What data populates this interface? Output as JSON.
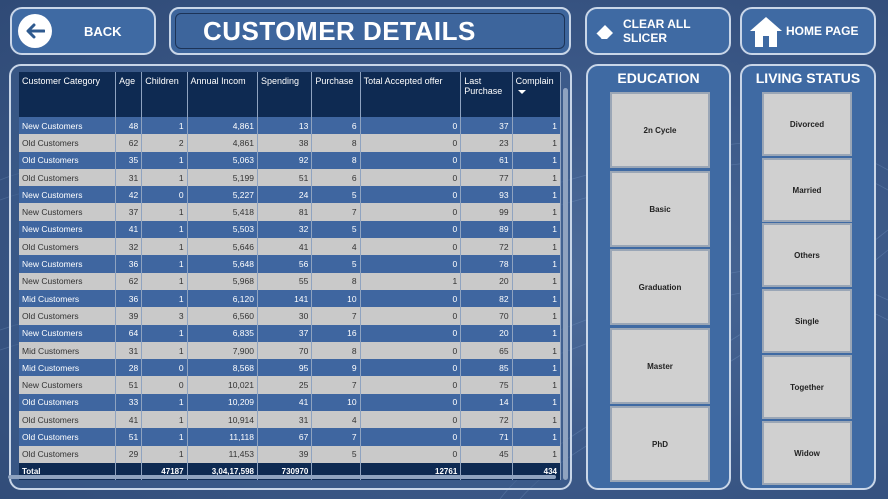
{
  "header": {
    "back_label": "BACK",
    "title": "CUSTOMER DETAILS",
    "clear_label": "CLEAR ALL SLICER",
    "home_label": "HOME PAGE"
  },
  "table": {
    "columns": [
      "Customer Category",
      "Age",
      "Children",
      "Annual Incom",
      "Spending",
      "Purchase",
      "Total Accepted offer",
      "Last Purchase",
      "Complain"
    ],
    "rows": [
      [
        "New Customers",
        "48",
        "1",
        "4,861",
        "13",
        "6",
        "0",
        "37",
        "1"
      ],
      [
        "Old Customers",
        "62",
        "2",
        "4,861",
        "38",
        "8",
        "0",
        "23",
        "1"
      ],
      [
        "Old Customers",
        "35",
        "1",
        "5,063",
        "92",
        "8",
        "0",
        "61",
        "1"
      ],
      [
        "Old Customers",
        "31",
        "1",
        "5,199",
        "51",
        "6",
        "0",
        "77",
        "1"
      ],
      [
        "New Customers",
        "42",
        "0",
        "5,227",
        "24",
        "5",
        "0",
        "93",
        "1"
      ],
      [
        "New Customers",
        "37",
        "1",
        "5,418",
        "81",
        "7",
        "0",
        "99",
        "1"
      ],
      [
        "New Customers",
        "41",
        "1",
        "5,503",
        "32",
        "5",
        "0",
        "89",
        "1"
      ],
      [
        "Old Customers",
        "32",
        "1",
        "5,646",
        "41",
        "4",
        "0",
        "72",
        "1"
      ],
      [
        "New Customers",
        "36",
        "1",
        "5,648",
        "56",
        "5",
        "0",
        "78",
        "1"
      ],
      [
        "New Customers",
        "62",
        "1",
        "5,968",
        "55",
        "8",
        "1",
        "20",
        "1"
      ],
      [
        "Mid Customers",
        "36",
        "1",
        "6,120",
        "141",
        "10",
        "0",
        "82",
        "1"
      ],
      [
        "Old Customers",
        "39",
        "3",
        "6,560",
        "30",
        "7",
        "0",
        "70",
        "1"
      ],
      [
        "New Customers",
        "64",
        "1",
        "6,835",
        "37",
        "16",
        "0",
        "20",
        "1"
      ],
      [
        "Mid Customers",
        "31",
        "1",
        "7,900",
        "70",
        "8",
        "0",
        "65",
        "1"
      ],
      [
        "Mid Customers",
        "28",
        "0",
        "8,568",
        "95",
        "9",
        "0",
        "85",
        "1"
      ],
      [
        "New Customers",
        "51",
        "0",
        "10,021",
        "25",
        "7",
        "0",
        "75",
        "1"
      ],
      [
        "Old Customers",
        "33",
        "1",
        "10,209",
        "41",
        "10",
        "0",
        "14",
        "1"
      ],
      [
        "Old Customers",
        "41",
        "1",
        "10,914",
        "31",
        "4",
        "0",
        "72",
        "1"
      ],
      [
        "Old Customers",
        "51",
        "1",
        "11,118",
        "67",
        "7",
        "0",
        "71",
        "1"
      ],
      [
        "Old Customers",
        "29",
        "1",
        "11,453",
        "39",
        "5",
        "0",
        "45",
        "1"
      ]
    ],
    "total": [
      "Total",
      "",
      "47187",
      "3,04,17,598",
      "730970",
      "",
      "12761",
      "",
      "434"
    ]
  },
  "education": {
    "title": "EDUCATION",
    "options": [
      "2n Cycle",
      "Basic",
      "Graduation",
      "Master",
      "PhD"
    ]
  },
  "living_status": {
    "title": "LIVING STATUS",
    "options": [
      "Divorced",
      "Married",
      "Others",
      "Single",
      "Together",
      "Widow"
    ]
  },
  "icons": {
    "back": "arrow-left-icon",
    "clear": "eraser-icon",
    "home": "home-icon",
    "sort": "sort-descending-icon"
  }
}
